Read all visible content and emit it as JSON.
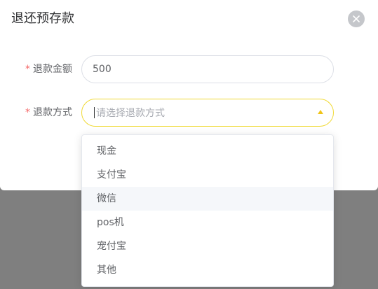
{
  "dialog": {
    "title": "退还预存款"
  },
  "form": {
    "required_mark": "*",
    "amount_label": "退款金额",
    "amount_value": "500",
    "method_label": "退款方式",
    "method_placeholder": "请选择退款方式"
  },
  "dropdown": {
    "options": [
      "现金",
      "支付宝",
      "微信",
      "pos机",
      "宠付宝",
      "其他"
    ],
    "hovered_option": "微信"
  },
  "colors": {
    "accent": "#f0d934",
    "required": "#f56c6c"
  },
  "icons": {
    "close": "close-icon",
    "arrow": "arrow-up-icon"
  }
}
